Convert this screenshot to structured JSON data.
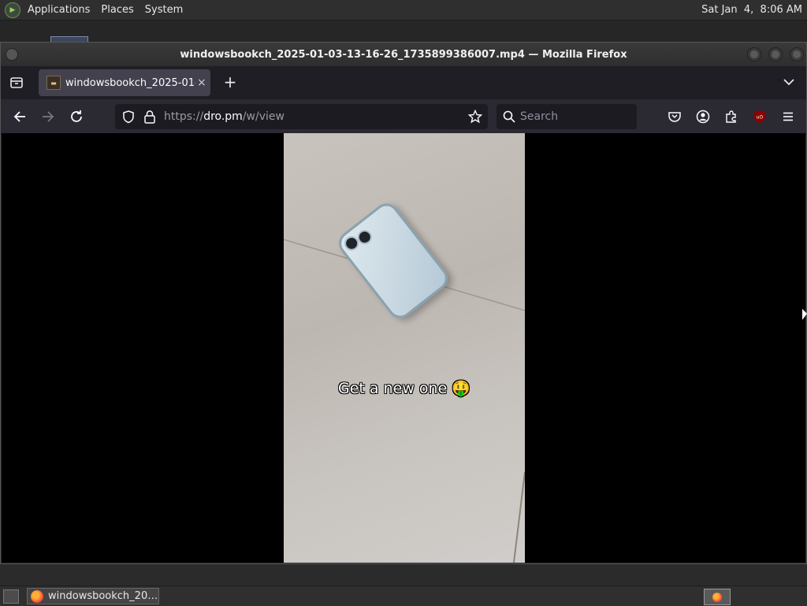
{
  "top_panel": {
    "menus": [
      "Applications",
      "Places",
      "System"
    ],
    "clock": "Sat Jan  4,  8:06 AM"
  },
  "window": {
    "title": "windowsbookch_2025-01-03-13-16-26_1735899386007.mp4 — Mozilla Firefox"
  },
  "tab": {
    "title": "windowsbookch_2025-01-03-13-16-26_1735899386007.mp4",
    "close_label": "×",
    "new_tab_label": "+"
  },
  "navbar": {
    "url_scheme": "https://",
    "url_host": "dro.pm",
    "url_path": "/w/view",
    "search_placeholder": "Search"
  },
  "video": {
    "caption": "Get a new one 🤑"
  },
  "taskbar": {
    "task_label": "windowsbookch_20…"
  },
  "colors": {
    "toolbar": "#2b2a33",
    "tab_active": "#42414d",
    "urlbar": "#1c1b22",
    "ublock_red": "#8b0000"
  }
}
